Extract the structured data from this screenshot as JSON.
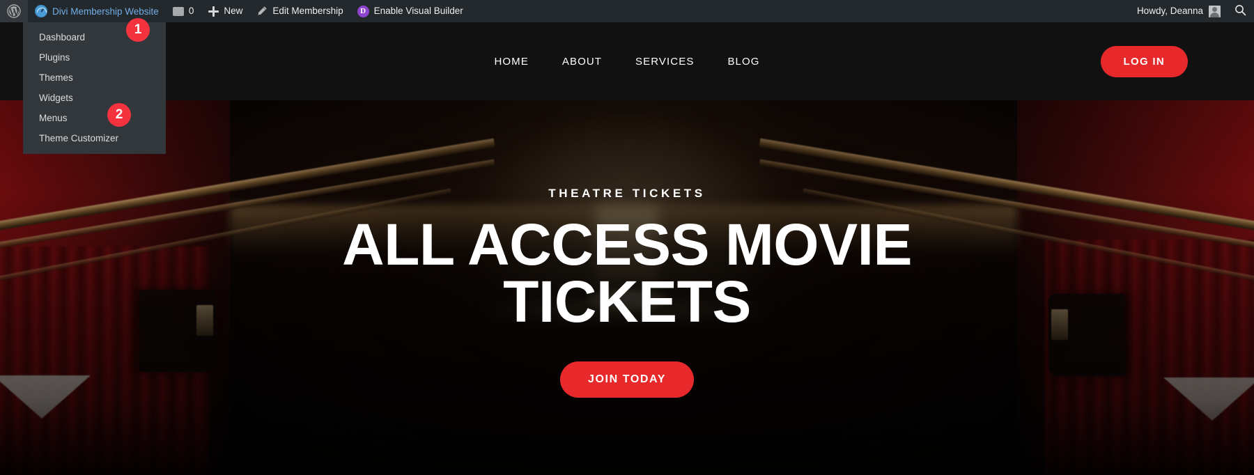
{
  "admin_bar": {
    "wp_logo": "wordpress-logo",
    "site_name": "Divi Membership Website",
    "site_icon": "dashboard-speedometer-icon",
    "comments": {
      "icon": "comment-bubble-icon",
      "count": "0"
    },
    "new": {
      "icon": "plus-icon",
      "label": "New"
    },
    "edit": {
      "icon": "pencil-icon",
      "label": "Edit Membership"
    },
    "visual_builder": {
      "icon": "divi-d-icon",
      "label": "Enable Visual Builder"
    },
    "howdy": "Howdy, Deanna",
    "avatar": "user-avatar",
    "search_icon": "search-icon"
  },
  "dropdown": {
    "items": [
      {
        "label": "Dashboard"
      },
      {
        "label": "Plugins"
      },
      {
        "label": "Themes"
      },
      {
        "label": "Widgets"
      },
      {
        "label": "Menus"
      },
      {
        "label": "Theme Customizer"
      }
    ]
  },
  "markers": [
    {
      "number": "1"
    },
    {
      "number": "2"
    }
  ],
  "site_header": {
    "nav": [
      {
        "label": "HOME"
      },
      {
        "label": "ABOUT"
      },
      {
        "label": "SERVICES"
      },
      {
        "label": "BLOG"
      }
    ],
    "login_label": "LOG IN"
  },
  "hero": {
    "eyebrow": "THEATRE TICKETS",
    "title": "ALL ACCESS MOVIE TICKETS",
    "cta_label": "JOIN TODAY"
  },
  "colors": {
    "admin_bar_bg": "#23282d",
    "dropdown_bg": "#32373c",
    "site_link": "#72aee6",
    "marker_red": "#f5333f",
    "brand_red": "#e8292b",
    "divi_purple": "#8f44ce",
    "header_bg": "#111111"
  }
}
